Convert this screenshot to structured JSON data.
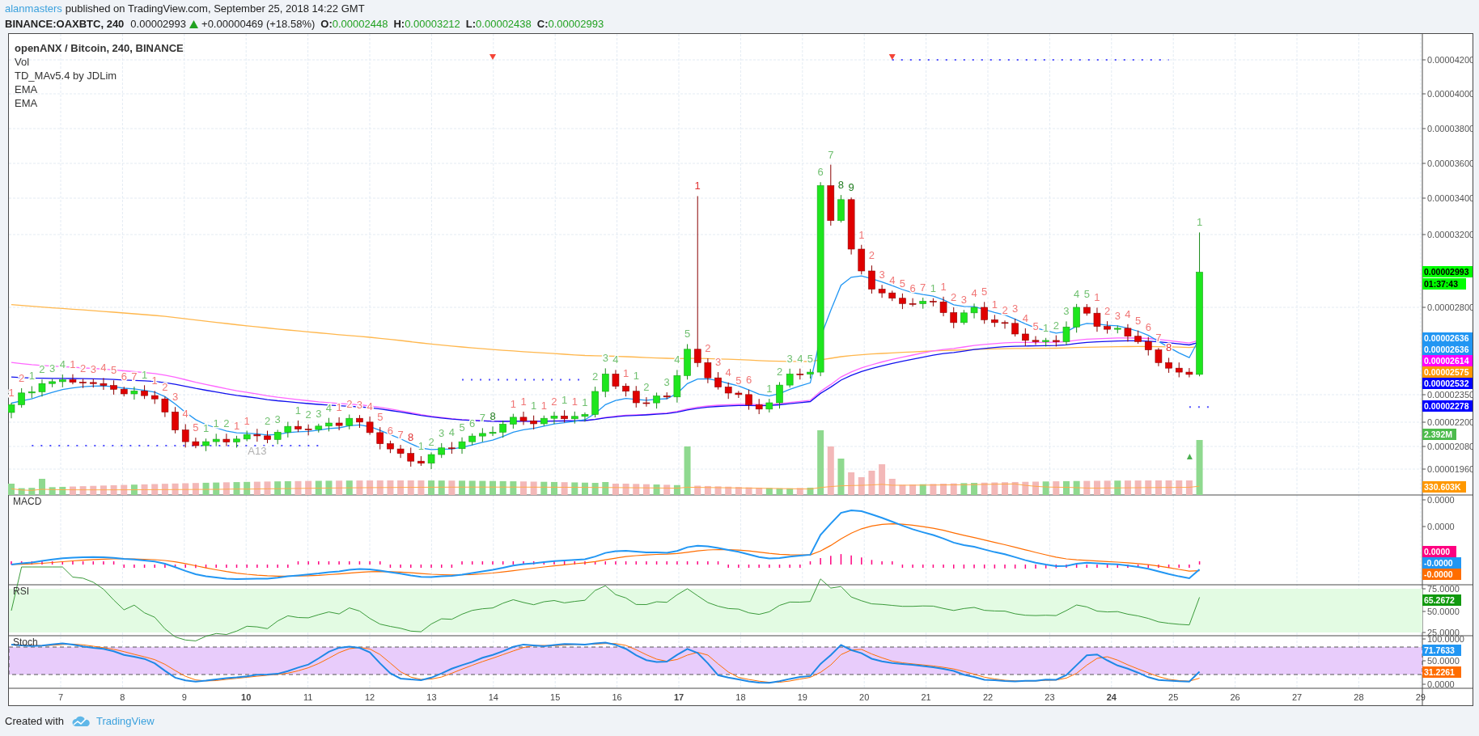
{
  "header": {
    "author": "alanmasters",
    "published": "published on TradingView.com, September 25, 2018 14:22 GMT"
  },
  "symbol_bar": {
    "symbol": "BINANCE:OAXBTC, 240",
    "last": "0.00002993",
    "change": "+0.00000469 (+18.58%)",
    "ohlc": [
      {
        "label": "O:",
        "value": "0.00002448"
      },
      {
        "label": "H:",
        "value": "0.00003212"
      },
      {
        "label": "L:",
        "value": "0.00002438"
      },
      {
        "label": "C:",
        "value": "0.00002993"
      }
    ]
  },
  "legend": [
    "openANX / Bitcoin, 240, BINANCE",
    "Vol",
    "TD_MAv5.4 by JDLim",
    "EMA",
    "EMA"
  ],
  "price_axis": {
    "ticks": [
      "0.00004200",
      "0.00004000",
      "0.00003800",
      "0.00003600",
      "0.00003400",
      "0.00003200",
      "0.00002800",
      "0.00002350",
      "0.00002200",
      "0.00002080",
      "0.00001960"
    ],
    "badges": [
      {
        "text": "0.00002993",
        "color": "#00ff00",
        "dark_text": true
      },
      {
        "text": "01:37:43",
        "color": "#00ff00",
        "dark_text": true
      },
      {
        "text": "0.00002636",
        "color": "#2196f3",
        "dark_text": false
      },
      {
        "text": "0.00002636",
        "color": "#2196f3",
        "dark_text": false
      },
      {
        "text": "0.00002614",
        "color": "#ff00ff",
        "dark_text": false
      },
      {
        "text": "0.00002575",
        "color": "#ff9800",
        "dark_text": false
      },
      {
        "text": "0.00002532",
        "color": "#0000ff",
        "dark_text": false
      },
      {
        "text": "0.00002278",
        "color": "#0000ff",
        "dark_text": false
      },
      {
        "text": "2.392M",
        "color": "#4cbb4c",
        "dark_text": false
      },
      {
        "text": "330.603K",
        "color": "#ff9800",
        "dark_text": false
      }
    ]
  },
  "td_labels": [
    {
      "text": "1",
      "color": "#f07575",
      "kind": "above"
    },
    {
      "text": "2",
      "color": "#f07575",
      "kind": "above"
    },
    {
      "text": "1",
      "color": "#70c070",
      "kind": "above"
    },
    {
      "text": "2",
      "color": "#70c070",
      "kind": "above"
    },
    {
      "text": "3",
      "color": "#70c070",
      "kind": "above"
    },
    {
      "text": "4",
      "color": "#70c070",
      "kind": "above"
    },
    {
      "text": "1",
      "color": "#f07575",
      "kind": "above"
    },
    {
      "text": "2",
      "color": "#f07575",
      "kind": "above"
    },
    {
      "text": "3",
      "color": "#f07575",
      "kind": "above"
    },
    {
      "text": "4",
      "color": "#f07575",
      "kind": "above"
    },
    {
      "text": "5",
      "color": "#f07575",
      "kind": "above"
    },
    {
      "text": "6",
      "color": "#f07575",
      "kind": "above"
    },
    {
      "text": "7",
      "color": "#f07575",
      "kind": "above"
    },
    {
      "text": "1",
      "color": "#70c070",
      "kind": "above"
    },
    {
      "text": "1",
      "color": "#f07575",
      "kind": "above"
    },
    {
      "text": "2",
      "color": "#f07575",
      "kind": "above"
    },
    {
      "text": "3",
      "color": "#f07575",
      "kind": "above"
    },
    {
      "text": "4",
      "color": "#f07575",
      "kind": "above"
    },
    {
      "text": "5",
      "color": "#f07575",
      "kind": "above"
    },
    {
      "text": "1",
      "color": "#70c070",
      "kind": "above"
    },
    {
      "text": "1",
      "color": "#70c070",
      "kind": "above"
    },
    {
      "text": "2",
      "color": "#70c070",
      "kind": "above"
    },
    {
      "text": "1",
      "color": "#f07575",
      "kind": "above"
    },
    {
      "text": "1",
      "color": "#f07575",
      "kind": "above"
    },
    {
      "text": "A13",
      "color": "#b0b0b0",
      "kind": "below"
    },
    {
      "text": "2",
      "color": "#70c070",
      "kind": "above"
    },
    {
      "text": "3",
      "color": "#70c070",
      "kind": "above"
    },
    {
      "text": "1",
      "color": "#70c070",
      "kind": "above"
    },
    {
      "text": "2",
      "color": "#70c070",
      "kind": "above"
    },
    {
      "text": "3",
      "color": "#70c070",
      "kind": "above"
    },
    {
      "text": "4",
      "color": "#70c070",
      "kind": "above"
    },
    {
      "text": "1",
      "color": "#f07575",
      "kind": "above"
    },
    {
      "text": "2",
      "color": "#f07575",
      "kind": "above"
    },
    {
      "text": "3",
      "color": "#f07575",
      "kind": "above"
    },
    {
      "text": "4",
      "color": "#f07575",
      "kind": "above"
    },
    {
      "text": "5",
      "color": "#f07575",
      "kind": "above"
    },
    {
      "text": "6",
      "color": "#f07575",
      "kind": "above"
    },
    {
      "text": "7",
      "color": "#f07575",
      "kind": "above"
    },
    {
      "text": "8",
      "color": "#e03030",
      "kind": "above"
    },
    {
      "text": "1",
      "color": "#70c070",
      "kind": "above"
    },
    {
      "text": "2",
      "color": "#70c070",
      "kind": "above"
    },
    {
      "text": "3",
      "color": "#70c070",
      "kind": "above"
    },
    {
      "text": "4",
      "color": "#70c070",
      "kind": "above"
    },
    {
      "text": "5",
      "color": "#70c070",
      "kind": "above"
    },
    {
      "text": "6",
      "color": "#70c070",
      "kind": "above"
    },
    {
      "text": "7",
      "color": "#70c070",
      "kind": "above"
    },
    {
      "text": "8",
      "color": "#1e7b1e",
      "kind": "above"
    },
    {
      "text": "1",
      "color": "#f07575",
      "kind": "above"
    },
    {
      "text": "1",
      "color": "#f07575",
      "kind": "above"
    },
    {
      "text": "1",
      "color": "#70c070",
      "kind": "above"
    },
    {
      "text": "1",
      "color": "#f07575",
      "kind": "above"
    },
    {
      "text": "2",
      "color": "#f07575",
      "kind": "above"
    },
    {
      "text": "1",
      "color": "#70c070",
      "kind": "above"
    },
    {
      "text": "1",
      "color": "#f07575",
      "kind": "above"
    },
    {
      "text": "1",
      "color": "#70c070",
      "kind": "above"
    },
    {
      "text": "2",
      "color": "#70c070",
      "kind": "above"
    },
    {
      "text": "3",
      "color": "#70c070",
      "kind": "above"
    },
    {
      "text": "4",
      "color": "#70c070",
      "kind": "above"
    },
    {
      "text": "1",
      "color": "#f07575",
      "kind": "above"
    },
    {
      "text": "1",
      "color": "#70c070",
      "kind": "above"
    },
    {
      "text": "2",
      "color": "#70c070",
      "kind": "above"
    },
    {
      "text": "3",
      "color": "#70c070",
      "kind": "above"
    },
    {
      "text": "4",
      "color": "#70c070",
      "kind": "above"
    },
    {
      "text": "5",
      "color": "#70c070",
      "kind": "above"
    },
    {
      "text": "1",
      "color": "#e03030",
      "kind": "above"
    },
    {
      "text": "2",
      "color": "#f07575",
      "kind": "above"
    },
    {
      "text": "3",
      "color": "#f07575",
      "kind": "above"
    },
    {
      "text": "4",
      "color": "#f07575",
      "kind": "above"
    },
    {
      "text": "5",
      "color": "#f07575",
      "kind": "above"
    },
    {
      "text": "6",
      "color": "#f07575",
      "kind": "above"
    },
    {
      "text": "1",
      "color": "#70c070",
      "kind": "above"
    },
    {
      "text": "2",
      "color": "#70c070",
      "kind": "above"
    },
    {
      "text": "3",
      "color": "#70c070",
      "kind": "above"
    },
    {
      "text": "4",
      "color": "#70c070",
      "kind": "above"
    },
    {
      "text": "5",
      "color": "#70c070",
      "kind": "above"
    },
    {
      "text": "6",
      "color": "#70c070",
      "kind": "above"
    },
    {
      "text": "7",
      "color": "#70c070",
      "kind": "above"
    },
    {
      "text": "8",
      "color": "#1e7b1e",
      "kind": "above"
    },
    {
      "text": "9",
      "color": "#1e7b1e",
      "kind": "above"
    },
    {
      "text": "1",
      "color": "#f07575",
      "kind": "above"
    },
    {
      "text": "2",
      "color": "#f07575",
      "kind": "above"
    },
    {
      "text": "3",
      "color": "#f07575",
      "kind": "above"
    },
    {
      "text": "4",
      "color": "#f07575",
      "kind": "above"
    },
    {
      "text": "5",
      "color": "#f07575",
      "kind": "above"
    },
    {
      "text": "6",
      "color": "#f07575",
      "kind": "above"
    },
    {
      "text": "7",
      "color": "#f07575",
      "kind": "above"
    },
    {
      "text": "1",
      "color": "#70c070",
      "kind": "above"
    },
    {
      "text": "1",
      "color": "#f07575",
      "kind": "above"
    },
    {
      "text": "2",
      "color": "#f07575",
      "kind": "above"
    },
    {
      "text": "3",
      "color": "#f07575",
      "kind": "above"
    },
    {
      "text": "4",
      "color": "#f07575",
      "kind": "above"
    },
    {
      "text": "5",
      "color": "#f07575",
      "kind": "above"
    },
    {
      "text": "1",
      "color": "#f07575",
      "kind": "above"
    },
    {
      "text": "2",
      "color": "#f07575",
      "kind": "above"
    },
    {
      "text": "3",
      "color": "#f07575",
      "kind": "above"
    },
    {
      "text": "4",
      "color": "#f07575",
      "kind": "above"
    },
    {
      "text": "5",
      "color": "#f07575",
      "kind": "above"
    },
    {
      "text": "1",
      "color": "#70c070",
      "kind": "above"
    },
    {
      "text": "2",
      "color": "#70c070",
      "kind": "above"
    },
    {
      "text": "3",
      "color": "#70c070",
      "kind": "above"
    },
    {
      "text": "4",
      "color": "#70c070",
      "kind": "above"
    },
    {
      "text": "5",
      "color": "#70c070",
      "kind": "above"
    },
    {
      "text": "1",
      "color": "#f07575",
      "kind": "above"
    },
    {
      "text": "2",
      "color": "#f07575",
      "kind": "above"
    },
    {
      "text": "3",
      "color": "#f07575",
      "kind": "above"
    },
    {
      "text": "4",
      "color": "#f07575",
      "kind": "above"
    },
    {
      "text": "5",
      "color": "#f07575",
      "kind": "above"
    },
    {
      "text": "6",
      "color": "#f07575",
      "kind": "above"
    },
    {
      "text": "7",
      "color": "#f07575",
      "kind": "above"
    },
    {
      "text": "8",
      "color": "#e03030",
      "kind": "above"
    },
    {
      "text": "1",
      "color": "#70c070",
      "kind": "above"
    }
  ],
  "panes": [
    {
      "kind": "macd",
      "title": "MACD",
      "ticks": [
        "0.0000",
        "0.0000"
      ],
      "badges": [
        {
          "text": "0.0000",
          "color": "#ff0080",
          "dark_text": false
        },
        {
          "text": "-0.0000",
          "color": "#2196f3",
          "dark_text": false
        },
        {
          "text": "-0.0000",
          "color": "#ff6d00",
          "dark_text": false
        }
      ]
    },
    {
      "kind": "rsi",
      "title": "RSI",
      "ticks": [
        "75.0000",
        "50.0000",
        "25.0000"
      ],
      "badges": [
        {
          "text": "65.2672",
          "color": "#11990f",
          "dark_text": false
        }
      ]
    },
    {
      "kind": "stoch",
      "title": "Stoch",
      "ticks": [
        "100.0000",
        "50.0000",
        "0.0000"
      ],
      "badges": [
        {
          "text": "71.7633",
          "color": "#2196f3",
          "dark_text": false
        },
        {
          "text": "31.2261",
          "color": "#ff6d00",
          "dark_text": false
        }
      ]
    }
  ],
  "time_axis": [
    {
      "label": "7",
      "bold": false
    },
    {
      "label": "8",
      "bold": false
    },
    {
      "label": "9",
      "bold": false
    },
    {
      "label": "10",
      "bold": true
    },
    {
      "label": "11",
      "bold": false
    },
    {
      "label": "12",
      "bold": false
    },
    {
      "label": "13",
      "bold": false
    },
    {
      "label": "14",
      "bold": false
    },
    {
      "label": "15",
      "bold": false
    },
    {
      "label": "16",
      "bold": false
    },
    {
      "label": "17",
      "bold": true
    },
    {
      "label": "18",
      "bold": false
    },
    {
      "label": "19",
      "bold": false
    },
    {
      "label": "20",
      "bold": false
    },
    {
      "label": "21",
      "bold": false
    },
    {
      "label": "22",
      "bold": false
    },
    {
      "label": "23",
      "bold": false
    },
    {
      "label": "24",
      "bold": true
    },
    {
      "label": "25",
      "bold": false
    },
    {
      "label": "26",
      "bold": false
    },
    {
      "label": "27",
      "bold": false
    },
    {
      "label": "28",
      "bold": false
    },
    {
      "label": "29",
      "bold": false
    }
  ],
  "footer": {
    "text": "Created with",
    "brand": "TradingView"
  }
}
